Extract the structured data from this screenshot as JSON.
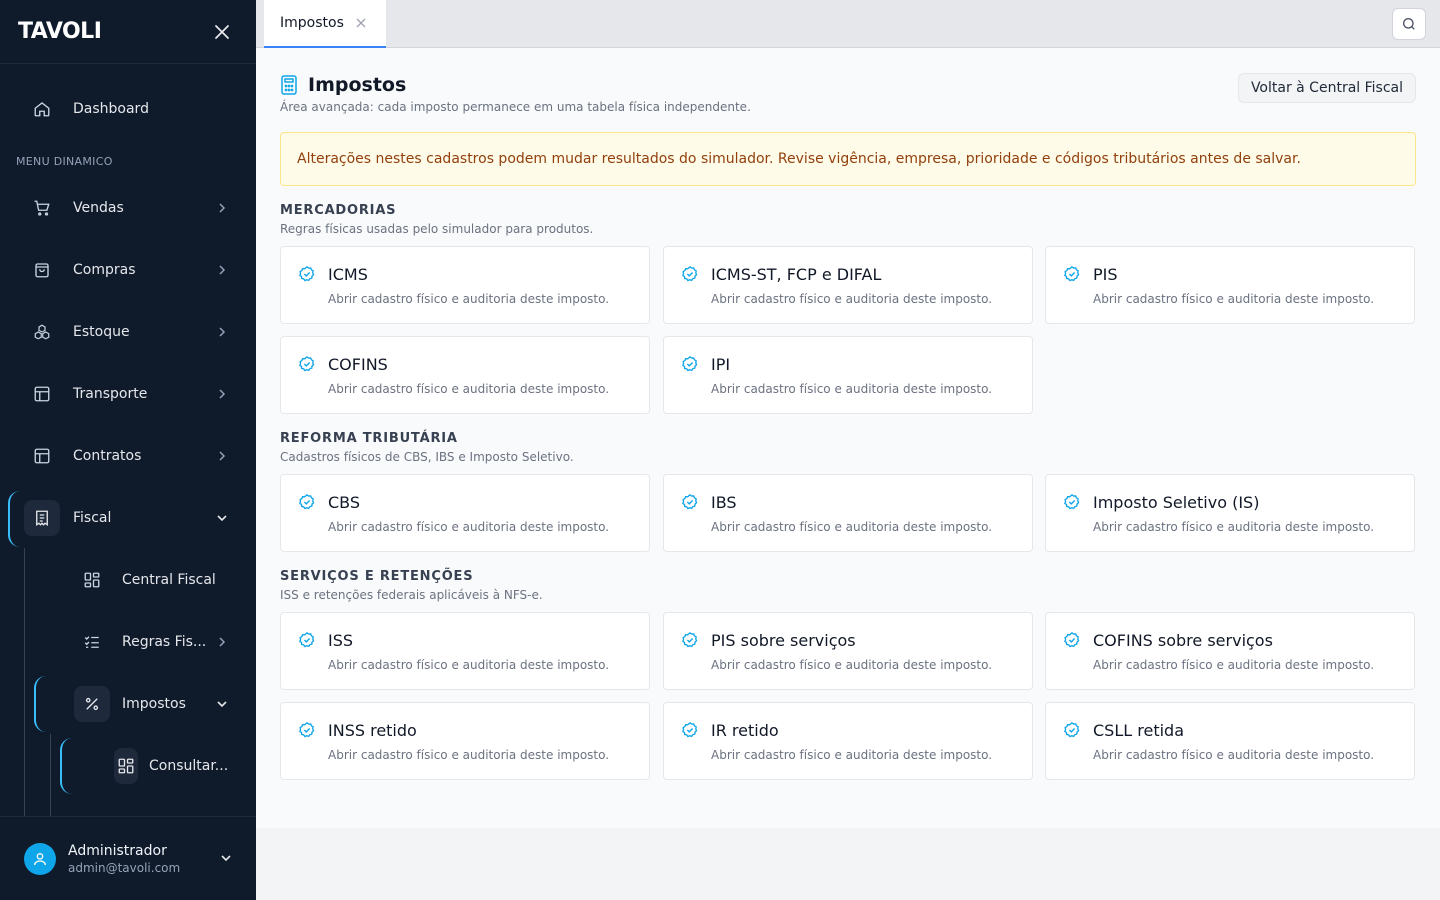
{
  "brand": "TAVOLI",
  "sidebar": {
    "dashboard": "Dashboard",
    "section_label": "MENU DINAMICO",
    "items": [
      {
        "label": "Vendas"
      },
      {
        "label": "Compras"
      },
      {
        "label": "Estoque"
      },
      {
        "label": "Transporte"
      },
      {
        "label": "Contratos"
      },
      {
        "label": "Fiscal"
      }
    ],
    "fiscal_children": [
      {
        "label": "Central Fiscal"
      },
      {
        "label": "Regras Fis..."
      },
      {
        "label": "Impostos"
      }
    ],
    "impostos_children": [
      {
        "label": "Consultar..."
      }
    ],
    "user": {
      "name": "Administrador",
      "email": "admin@tavoli.com"
    }
  },
  "tabs": [
    {
      "label": "Impostos"
    }
  ],
  "page": {
    "title": "Impostos",
    "subtitle": "Área avançada: cada imposto permanece em uma tabela física independente.",
    "back_button": "Voltar à Central Fiscal",
    "alert": "Alterações nestes cadastros podem mudar resultados do simulador. Revise vigência, empresa, prioridade e códigos tributários antes de salvar."
  },
  "card_desc": "Abrir cadastro físico e auditoria deste imposto.",
  "sections": [
    {
      "title": "MERCADORIAS",
      "subtitle": "Regras físicas usadas pelo simulador para produtos.",
      "cards": [
        "ICMS",
        "ICMS-ST, FCP e DIFAL",
        "PIS",
        "COFINS",
        "IPI"
      ]
    },
    {
      "title": "REFORMA TRIBUTÁRIA",
      "subtitle": "Cadastros físicos de CBS, IBS e Imposto Seletivo.",
      "cards": [
        "CBS",
        "IBS",
        "Imposto Seletivo (IS)"
      ]
    },
    {
      "title": "SERVIÇOS E RETENÇÕES",
      "subtitle": "ISS e retenções federais aplicáveis à NFS-e.",
      "cards": [
        "ISS",
        "PIS sobre serviços",
        "COFINS sobre serviços",
        "INSS retido",
        "IR retido",
        "CSLL retida"
      ]
    }
  ],
  "colors": {
    "sidebar_bg": "#0f1a2b",
    "accent": "#0ea5e9",
    "alert_bg": "#fefce8",
    "alert_text": "#92400e"
  }
}
